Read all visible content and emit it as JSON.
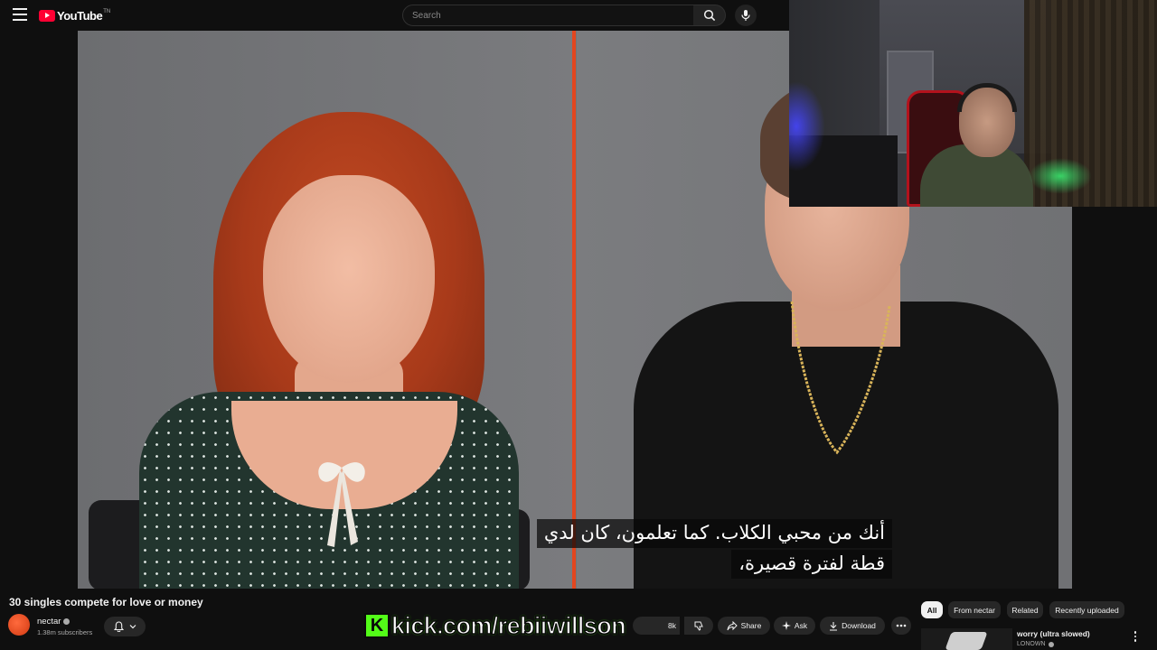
{
  "header": {
    "logo_text": "YouTube",
    "country_code": "TN",
    "search_placeholder": "Search"
  },
  "video": {
    "caption_line_1": "أنك من محبي الكلاب. كما تعلمون، كان لدي",
    "caption_line_2": "قطة لفترة قصيرة،",
    "title": "30 singles compete for love or money"
  },
  "channel": {
    "name": "nectar",
    "subscribers": "1.38m subscribers"
  },
  "actions": {
    "like_label": "8k",
    "share": "Share",
    "ask": "Ask",
    "download": "Download"
  },
  "overlay": {
    "kick_logo_letter": "K",
    "kick_url": "kick.com/rebiiwillson"
  },
  "chips": [
    "All",
    "From nectar",
    "Related",
    "Recently uploaded"
  ],
  "related": {
    "title": "worry (ultra slowed)",
    "channel": "LONOWN"
  },
  "icons": {
    "menu": "menu-icon",
    "search": "search-icon",
    "mic": "mic-icon",
    "bell": "bell-icon",
    "dislike": "thumbs-down-icon",
    "share": "share-icon",
    "ask": "sparkle-icon",
    "download": "download-icon",
    "more": "more-vert-icon"
  },
  "colors": {
    "brand_red": "#ff0033",
    "kick_green": "#53fc18",
    "divider_orange": "#e2461f"
  }
}
